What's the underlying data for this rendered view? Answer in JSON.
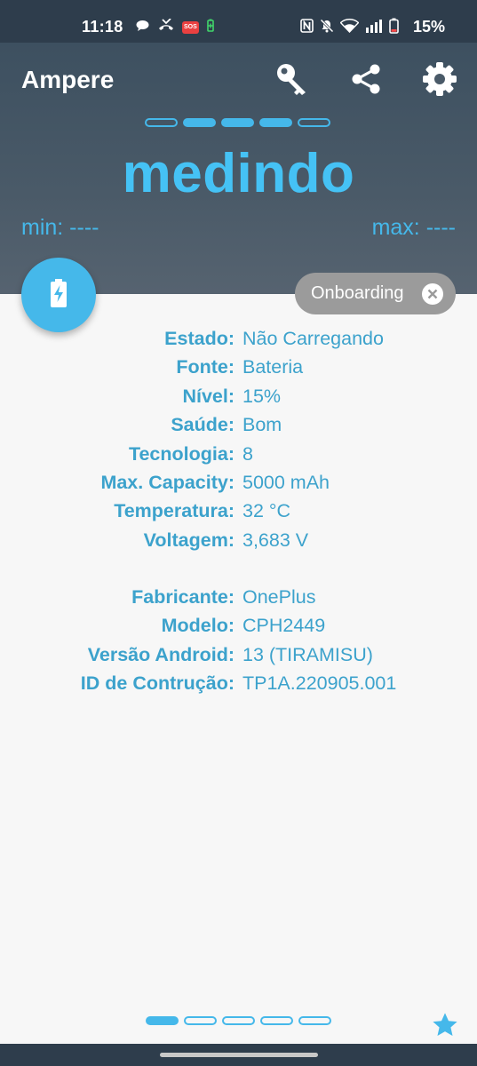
{
  "status_bar": {
    "time": "11:18",
    "sos_label": "SOS",
    "battery_percent": "15%"
  },
  "header": {
    "app_title": "Ampere",
    "icons": [
      "key-icon",
      "share-icon",
      "gear-icon"
    ],
    "measure_label": "medindo",
    "min_label": "min: ----",
    "max_label": "max: ----",
    "page_indicator": {
      "total": 5,
      "active": [
        1,
        2,
        3
      ]
    }
  },
  "fab": {
    "icon": "battery-charging-icon"
  },
  "chip": {
    "label": "Onboarding",
    "icon": "close-icon"
  },
  "battery_info": [
    {
      "label": "Estado:",
      "value": "Não Carregando"
    },
    {
      "label": "Fonte:",
      "value": "Bateria"
    },
    {
      "label": "Nível:",
      "value": "15%"
    },
    {
      "label": "Saúde:",
      "value": "Bom"
    },
    {
      "label": "Tecnologia:",
      "value": "8"
    },
    {
      "label": "Max. Capacity:",
      "value": "5000 mAh"
    },
    {
      "label": "Temperatura:",
      "value": "32 °C"
    },
    {
      "label": "Voltagem:",
      "value": "3,683 V"
    }
  ],
  "device_info": [
    {
      "label": "Fabricante:",
      "value": "OnePlus"
    },
    {
      "label": "Modelo:",
      "value": "CPH2449"
    },
    {
      "label": "Versão Android:",
      "value": "13 (TIRAMISU)"
    },
    {
      "label": "ID de Contrução:",
      "value": "TP1A.220905.001"
    }
  ],
  "bottom": {
    "page_indicator": {
      "total": 5,
      "active": [
        0
      ]
    },
    "icon": "star-icon"
  },
  "colors": {
    "accent": "#45b8ea",
    "header_bg": "#46566a",
    "status_bar_bg": "#2e3d4c",
    "chip_bg": "#9b9b9b",
    "background": "#f7f7f7"
  }
}
